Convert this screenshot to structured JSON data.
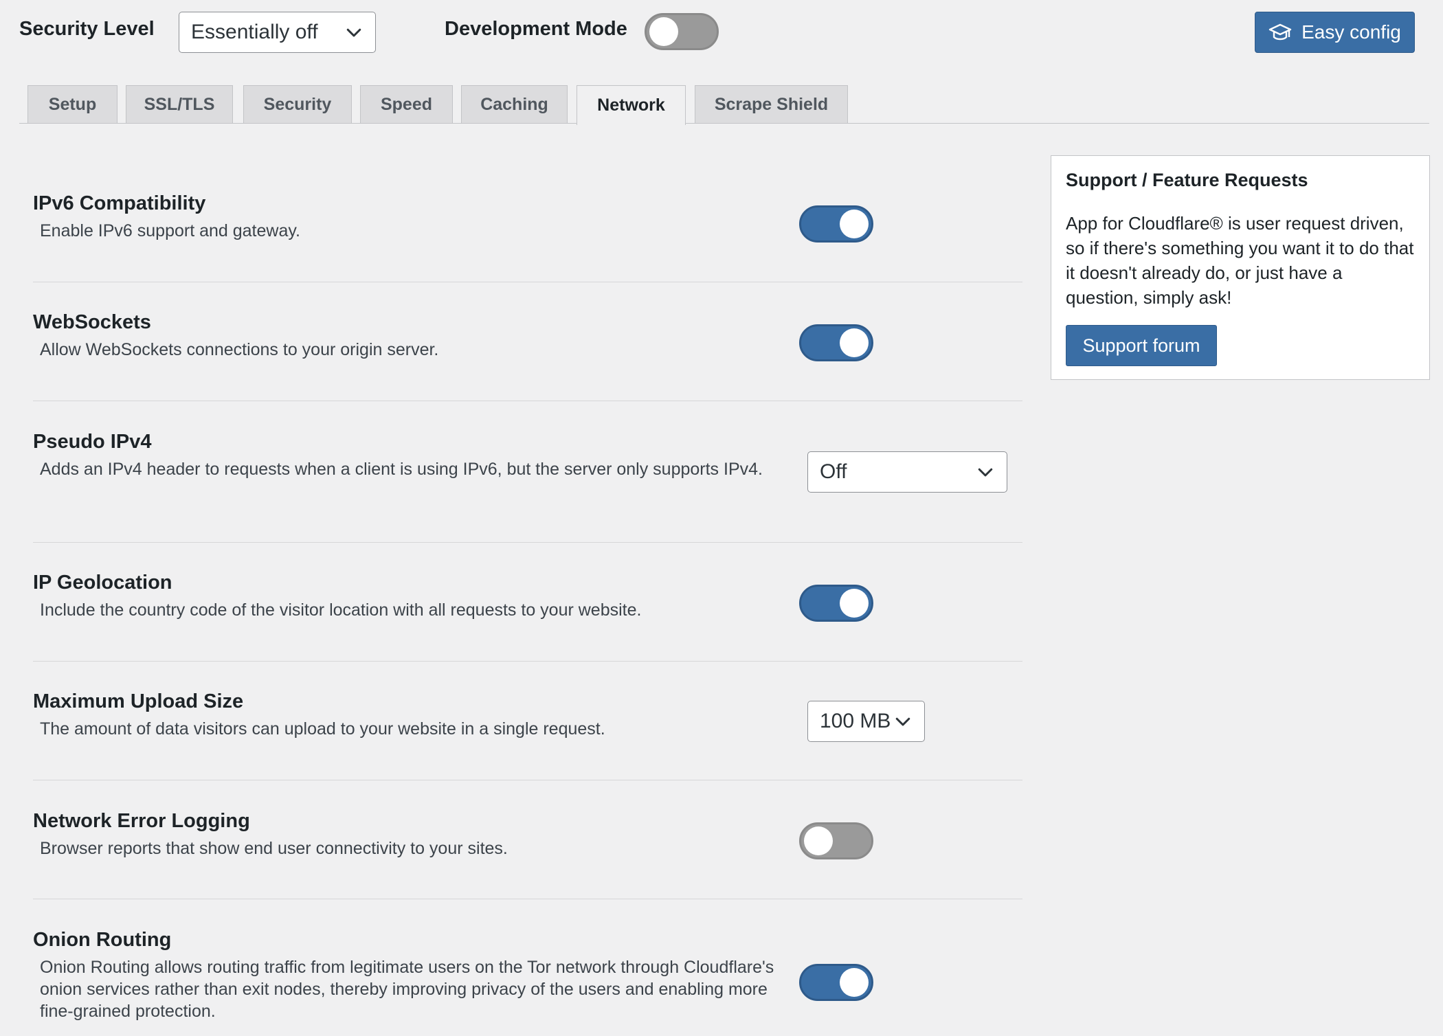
{
  "topbar": {
    "security_level_label": "Security Level",
    "security_level_value": "Essentially off",
    "development_mode_label": "Development Mode",
    "development_mode_on": false,
    "easy_config_label": "Easy config"
  },
  "tabs": [
    {
      "label": "Setup",
      "active": false
    },
    {
      "label": "SSL/TLS",
      "active": false
    },
    {
      "label": "Security",
      "active": false
    },
    {
      "label": "Speed",
      "active": false
    },
    {
      "label": "Caching",
      "active": false
    },
    {
      "label": "Network",
      "active": true
    },
    {
      "label": "Scrape Shield",
      "active": false
    }
  ],
  "settings": {
    "ipv6": {
      "title": "IPv6 Compatibility",
      "description": "Enable IPv6 support and gateway.",
      "enabled": true
    },
    "websockets": {
      "title": "WebSockets",
      "description": "Allow WebSockets connections to your origin server.",
      "enabled": true
    },
    "pseudo_ipv4": {
      "title": "Pseudo IPv4",
      "description": "Adds an IPv4 header to requests when a client is using IPv6, but the server only supports IPv4.",
      "value": "Off"
    },
    "ip_geolocation": {
      "title": "IP Geolocation",
      "description": "Include the country code of the visitor location with all requests to your website.",
      "enabled": true
    },
    "max_upload": {
      "title": "Maximum Upload Size",
      "description": "The amount of data visitors can upload to your website in a single request.",
      "value": "100 MB"
    },
    "network_error_logging": {
      "title": "Network Error Logging",
      "description": "Browser reports that show end user connectivity to your sites.",
      "enabled": false
    },
    "onion_routing": {
      "title": "Onion Routing",
      "description": "Onion Routing allows routing traffic from legitimate users on the Tor network through Cloudflare's onion services rather than exit nodes, thereby improving privacy of the users and enabling more fine-grained protection.",
      "enabled": true
    }
  },
  "sidebar": {
    "title": "Support / Feature Requests",
    "body": "App for Cloudflare® is user request driven, so if there's something you want it to do that it doesn't already do, or just have a question, simply ask!",
    "button_label": "Support forum"
  },
  "colors": {
    "accent": "#3a6ea5",
    "toggle_off": "#9a9a9a",
    "background": "#f0f0f1"
  },
  "icons": {
    "easy_config": "graduation-cap-icon",
    "select": "chevron-down-icon"
  }
}
